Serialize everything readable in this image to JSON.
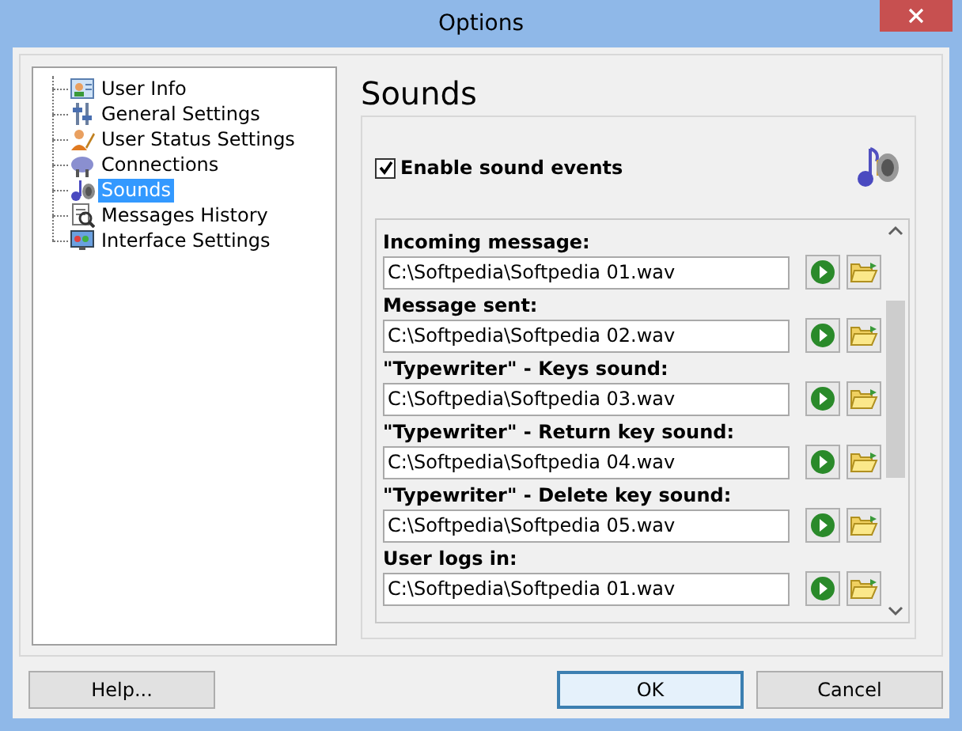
{
  "window": {
    "title": "Options"
  },
  "tree": {
    "items": [
      {
        "label": "User Info",
        "selected": false
      },
      {
        "label": "General Settings",
        "selected": false
      },
      {
        "label": "User Status Settings",
        "selected": false
      },
      {
        "label": "Connections",
        "selected": false
      },
      {
        "label": "Sounds",
        "selected": true
      },
      {
        "label": "Messages History",
        "selected": false
      },
      {
        "label": "Interface Settings",
        "selected": false
      }
    ]
  },
  "page": {
    "heading": "Sounds",
    "enable": {
      "label": "Enable sound events",
      "checked": true
    },
    "sounds": [
      {
        "label": "Incoming message:",
        "value": "C:\\Softpedia\\Softpedia 01.wav"
      },
      {
        "label": "Message sent:",
        "value": "C:\\Softpedia\\Softpedia 02.wav"
      },
      {
        "label": "\"Typewriter\" - Keys sound:",
        "value": "C:\\Softpedia\\Softpedia 03.wav"
      },
      {
        "label": "\"Typewriter\" - Return key sound:",
        "value": "C:\\Softpedia\\Softpedia 04.wav"
      },
      {
        "label": "\"Typewriter\" - Delete key sound:",
        "value": "C:\\Softpedia\\Softpedia 05.wav"
      },
      {
        "label": "User logs in:",
        "value": "C:\\Softpedia\\Softpedia 01.wav"
      }
    ]
  },
  "buttons": [
    {
      "label": "Help...",
      "kind": "normal"
    },
    {
      "label": "OK",
      "kind": "default"
    },
    {
      "label": "Cancel",
      "kind": "normal"
    }
  ]
}
